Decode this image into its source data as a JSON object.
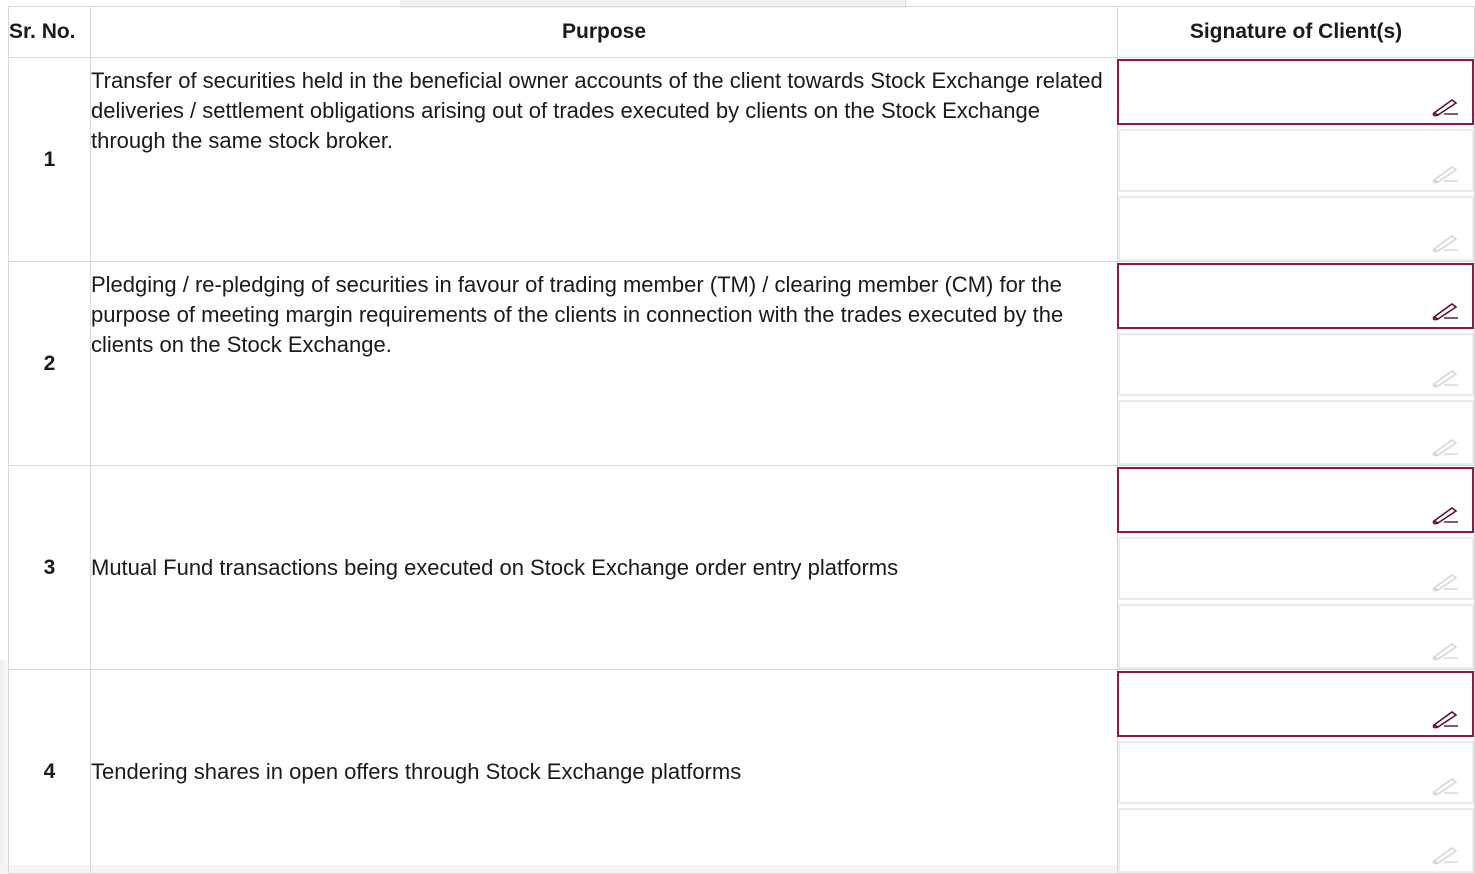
{
  "table": {
    "headers": {
      "sr_no": "Sr. No.",
      "purpose": "Purpose",
      "signature": "Signature of Client(s)"
    },
    "rows": [
      {
        "sr": "1",
        "purpose": "Transfer of securities held in the beneficial owner accounts of the client towards Stock Exchange related deliveries / settlement obligations arising out of trades executed by clients on the Stock Exchange through the same stock broker."
      },
      {
        "sr": "2",
        "purpose": "Pledging / re-pledging of securities in favour of trading member (TM) / clearing member (CM) for the purpose of meeting margin requirements of the clients in connection with the trades executed by the clients on the Stock Exchange."
      },
      {
        "sr": "3",
        "purpose": "Mutual Fund transactions being executed on Stock Exchange order entry platforms"
      },
      {
        "sr": "4",
        "purpose": "Tendering shares in open offers through Stock Exchange platforms"
      }
    ]
  },
  "icons": {
    "signature_field": "pen-signature-icon"
  },
  "colors": {
    "active_signature_border": "#8b1a4a",
    "inactive_signature_border": "#ebebeb",
    "grid_line": "#d9d9d9"
  }
}
